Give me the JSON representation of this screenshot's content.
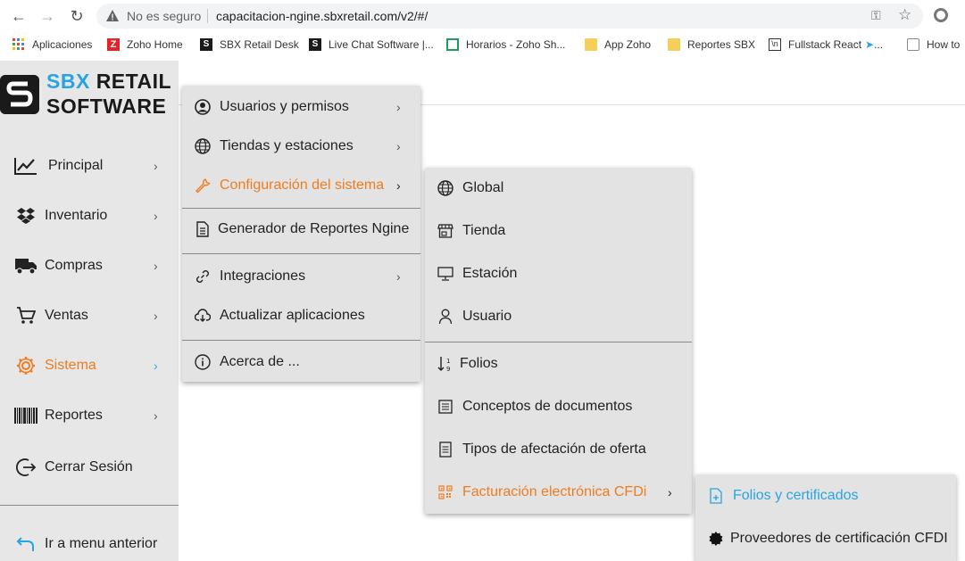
{
  "browser": {
    "security_label": "No es seguro",
    "url": "capacitacion-ngine.sbxretail.com/v2/#/",
    "bookmarks": [
      {
        "label": "Aplicaciones",
        "icon": "apps-grid-icon"
      },
      {
        "label": "Zoho Home",
        "icon": "zoho-icon"
      },
      {
        "label": "SBX Retail Desk",
        "icon": "sbx-icon"
      },
      {
        "label": "Live Chat Software |...",
        "icon": "sbx-icon"
      },
      {
        "label": "Horarios - Zoho Sh...",
        "icon": "sheet-icon"
      },
      {
        "label": "App Zoho",
        "icon": "folder-icon"
      },
      {
        "label": "Reportes SBX",
        "icon": "folder-icon"
      },
      {
        "label": "Fullstack React",
        "icon": "fullstack-icon"
      },
      {
        "label": "How to",
        "icon": "page-icon"
      }
    ]
  },
  "logo": {
    "line1_a": "SBX",
    "line1_b": "RETAIL",
    "line2": "SOFTWARE"
  },
  "sidebar": {
    "items": [
      {
        "label": "Principal",
        "icon": "chart-line-icon"
      },
      {
        "label": "Inventario",
        "icon": "dropbox-icon"
      },
      {
        "label": "Compras",
        "icon": "truck-icon"
      },
      {
        "label": "Ventas",
        "icon": "cart-icon"
      },
      {
        "label": "Sistema",
        "icon": "gear-icon"
      },
      {
        "label": "Reportes",
        "icon": "barcode-icon"
      }
    ],
    "logout": "Cerrar Sesión",
    "back": "Ir a menu anterior"
  },
  "menu1": {
    "items": [
      {
        "label": "Usuarios y permisos",
        "icon": "user-circle-icon"
      },
      {
        "label": "Tiendas y estaciones",
        "icon": "globe-icon"
      },
      {
        "label": "Configuración del sistema",
        "icon": "wrench-icon"
      },
      {
        "label": "Generador de Reportes Ngine",
        "icon": "document-icon"
      },
      {
        "label": "Integraciones",
        "icon": "link-icon"
      },
      {
        "label": "Actualizar aplicaciones",
        "icon": "cloud-download-icon"
      },
      {
        "label": "Acerca de ...",
        "icon": "info-icon"
      }
    ]
  },
  "menu2": {
    "items": [
      {
        "label": "Global",
        "icon": "globe-icon"
      },
      {
        "label": "Tienda",
        "icon": "store-icon"
      },
      {
        "label": "Estación",
        "icon": "monitor-icon"
      },
      {
        "label": "Usuario",
        "icon": "user-icon"
      },
      {
        "label": "Folios",
        "icon": "sort-numeric-icon"
      },
      {
        "label": "Conceptos de documentos",
        "icon": "list-doc-icon"
      },
      {
        "label": "Tipos de afectación de oferta",
        "icon": "receipt-icon"
      },
      {
        "label": "Facturación electrónica CFDi",
        "icon": "qrcode-icon"
      }
    ]
  },
  "menu3": {
    "items": [
      {
        "label": "Folios y certificados",
        "icon": "file-plus-icon"
      },
      {
        "label": "Proveedores de certificación CFDI",
        "icon": "certificate-icon"
      }
    ]
  },
  "colors": {
    "accent_orange": "#f07c22",
    "accent_blue": "#2aa4e0",
    "sidebar_bg": "#e7e7e7",
    "menu_bg": "#e3e3e3"
  }
}
